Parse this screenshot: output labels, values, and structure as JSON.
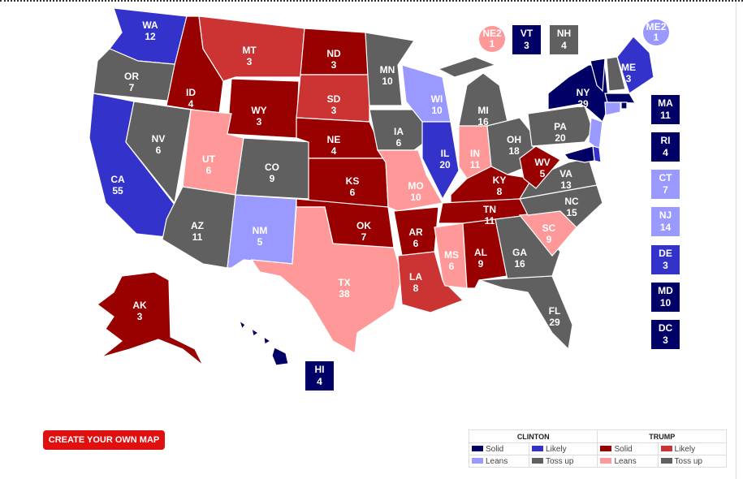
{
  "colors": {
    "solid_d": "#000066",
    "likely_d": "#3333cc",
    "leans_d": "#9999ff",
    "tossup": "#606060",
    "solid_r": "#990000",
    "likely_r": "#cc3333",
    "leans_r": "#ff9999"
  },
  "states": {
    "WA": {
      "ev": "12",
      "r": "likely_d"
    },
    "OR": {
      "ev": "7",
      "r": "tossup"
    },
    "CA": {
      "ev": "55",
      "r": "likely_d"
    },
    "NV": {
      "ev": "6",
      "r": "tossup"
    },
    "ID": {
      "ev": "4",
      "r": "solid_r"
    },
    "MT": {
      "ev": "3",
      "r": "likely_r"
    },
    "WY": {
      "ev": "3",
      "r": "solid_r"
    },
    "UT": {
      "ev": "6",
      "r": "leans_r"
    },
    "AZ": {
      "ev": "11",
      "r": "tossup"
    },
    "CO": {
      "ev": "9",
      "r": "tossup"
    },
    "NM": {
      "ev": "5",
      "r": "leans_d"
    },
    "ND": {
      "ev": "3",
      "r": "solid_r"
    },
    "SD": {
      "ev": "3",
      "r": "likely_r"
    },
    "NE": {
      "ev": "4",
      "r": "solid_r"
    },
    "KS": {
      "ev": "6",
      "r": "solid_r"
    },
    "OK": {
      "ev": "7",
      "r": "solid_r"
    },
    "TX": {
      "ev": "38",
      "r": "leans_r"
    },
    "MN": {
      "ev": "10",
      "r": "tossup"
    },
    "IA": {
      "ev": "6",
      "r": "tossup"
    },
    "MO": {
      "ev": "10",
      "r": "leans_r"
    },
    "AR": {
      "ev": "6",
      "r": "solid_r"
    },
    "LA": {
      "ev": "8",
      "r": "likely_r"
    },
    "WI": {
      "ev": "10",
      "r": "leans_d"
    },
    "IL": {
      "ev": "20",
      "r": "likely_d"
    },
    "MI": {
      "ev": "16",
      "r": "tossup"
    },
    "IN": {
      "ev": "11",
      "r": "leans_r"
    },
    "OH": {
      "ev": "18",
      "r": "tossup"
    },
    "KY": {
      "ev": "8",
      "r": "solid_r"
    },
    "TN": {
      "ev": "11",
      "r": "solid_r"
    },
    "MS": {
      "ev": "6",
      "r": "leans_r"
    },
    "AL": {
      "ev": "9",
      "r": "solid_r"
    },
    "GA": {
      "ev": "16",
      "r": "tossup"
    },
    "FL": {
      "ev": "29",
      "r": "tossup"
    },
    "SC": {
      "ev": "9",
      "r": "leans_r"
    },
    "NC": {
      "ev": "15",
      "r": "tossup"
    },
    "VA": {
      "ev": "13",
      "r": "tossup"
    },
    "WV": {
      "ev": "5",
      "r": "solid_r"
    },
    "PA": {
      "ev": "20",
      "r": "tossup"
    },
    "NY": {
      "ev": "29",
      "r": "solid_d"
    },
    "ME": {
      "ev": "3",
      "r": "likely_d"
    },
    "AK": {
      "ev": "3",
      "r": "solid_r"
    },
    "HI": {
      "ev": "4",
      "r": "solid_d"
    },
    "VT": {
      "ev": "3",
      "r": "solid_d"
    },
    "NH": {
      "ev": "4",
      "r": "tossup"
    },
    "MA": {
      "ev": "11",
      "r": "solid_d"
    },
    "RI": {
      "ev": "4",
      "r": "solid_d"
    },
    "CT": {
      "ev": "7",
      "r": "leans_d"
    },
    "NJ": {
      "ev": "14",
      "r": "leans_d"
    },
    "DE": {
      "ev": "3",
      "r": "likely_d"
    },
    "MD": {
      "ev": "10",
      "r": "solid_d"
    },
    "DC": {
      "ev": "3",
      "r": "solid_d"
    },
    "NE2": {
      "ev": "1",
      "r": "leans_r"
    },
    "ME2": {
      "ev": "1",
      "r": "leans_d"
    }
  },
  "button": {
    "label": "CREATE YOUR OWN MAP"
  },
  "legend": {
    "clinton": "CLINTON",
    "trump": "TRUMP",
    "solid": "Solid",
    "likely": "Likely",
    "leans": "Leans",
    "tossup": "Toss up"
  }
}
